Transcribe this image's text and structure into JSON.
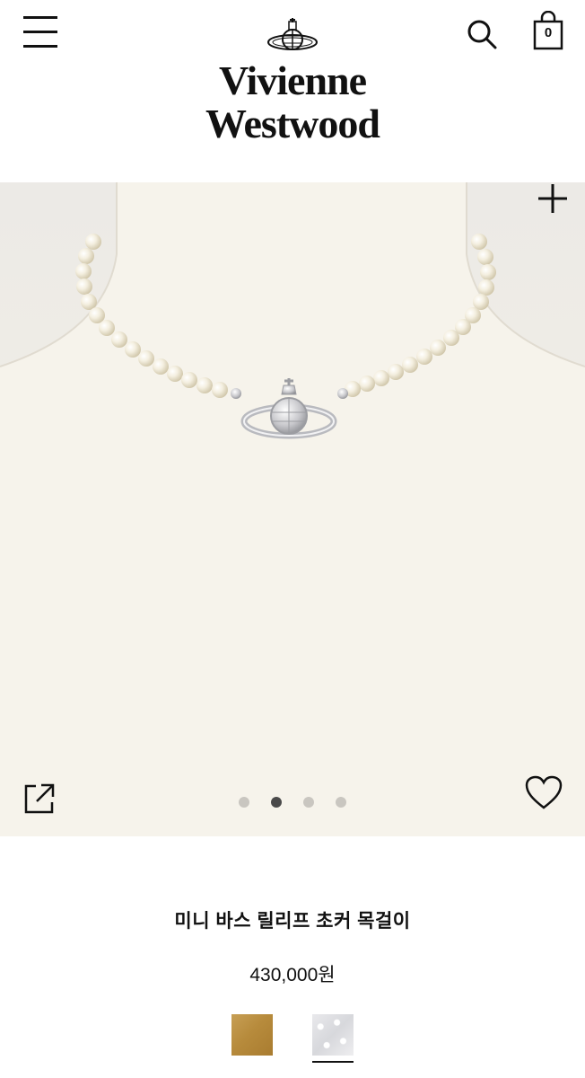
{
  "header": {
    "brand_line1": "Vivienne",
    "brand_line2": "Westwood",
    "menu_icon": "hamburger-menu-icon",
    "search_icon": "search-icon",
    "bag_icon": "shopping-bag-icon",
    "bag_count": "0"
  },
  "gallery": {
    "zoom_icon": "plus-icon",
    "share_icon": "share-external-icon",
    "wishlist_icon": "heart-icon",
    "slide_count": 4,
    "active_slide": 2
  },
  "product": {
    "name": "미니 바스 릴리프 초커 목걸이",
    "price": "430,000원",
    "swatches": [
      {
        "name": "gold",
        "color": "#b88c40"
      },
      {
        "name": "silver",
        "color": "#dcdde0",
        "selected": true
      }
    ]
  }
}
